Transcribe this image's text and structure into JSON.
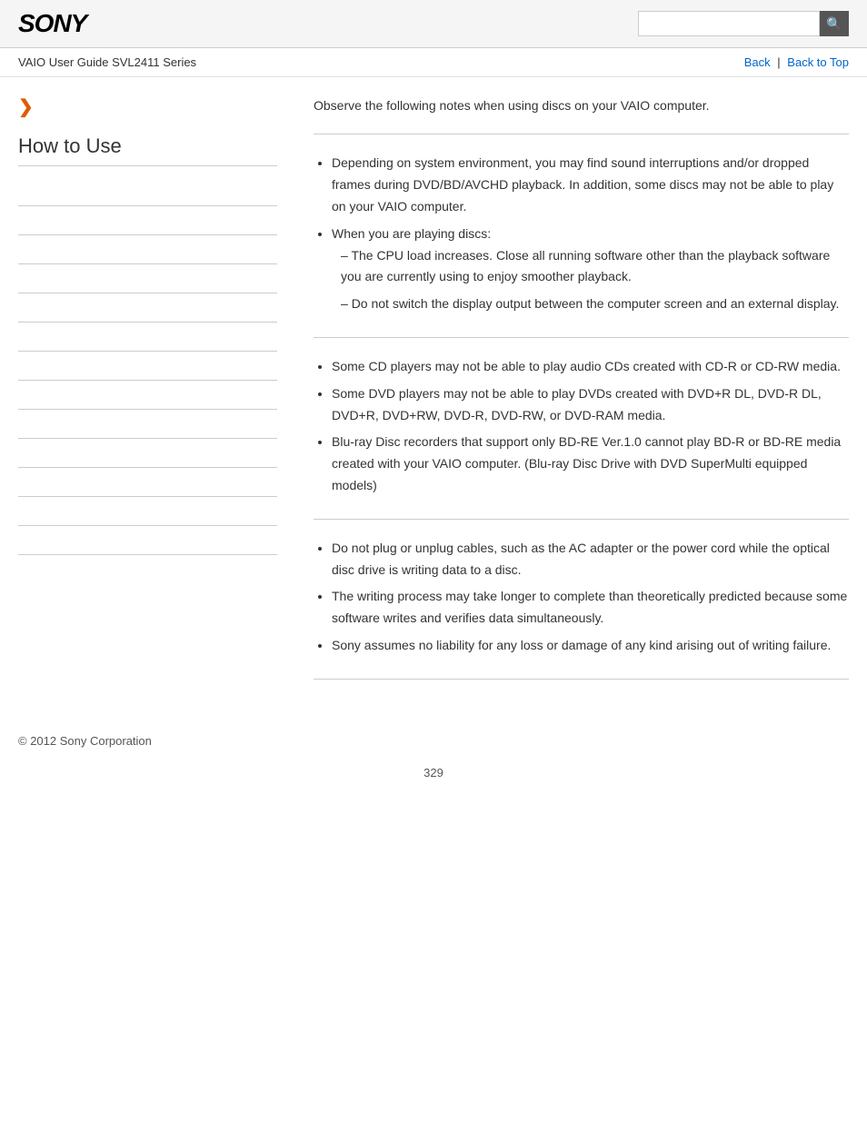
{
  "header": {
    "logo": "SONY",
    "search_placeholder": "",
    "search_icon": "🔍"
  },
  "nav": {
    "breadcrumb": "VAIO User Guide SVL2411 Series",
    "back_label": "Back",
    "separator": "|",
    "back_to_top_label": "Back to Top"
  },
  "sidebar": {
    "chevron": "❯",
    "title": "How to Use",
    "nav_items": [
      "",
      "",
      "",
      "",
      "",
      "",
      "",
      "",
      "",
      "",
      "",
      "",
      ""
    ]
  },
  "content": {
    "intro": "Observe the following notes when using discs on your VAIO computer.",
    "section1": {
      "items": [
        "Depending on system environment, you may find sound interruptions and/or dropped frames during DVD/BD/AVCHD playback. In addition, some discs may not be able to play on your VAIO computer.",
        "When you are playing discs:"
      ],
      "sub_items": [
        "The CPU load increases. Close all running software other than the playback software you are currently using to enjoy smoother playback.",
        "Do not switch the display output between the computer screen and an external display."
      ]
    },
    "section2": {
      "items": [
        "Some CD players may not be able to play audio CDs created with CD-R or CD-RW media.",
        "Some DVD players may not be able to play DVDs created with DVD+R DL, DVD-R DL, DVD+R, DVD+RW, DVD-R, DVD-RW, or DVD-RAM media.",
        "Blu-ray Disc recorders that support only BD-RE Ver.1.0 cannot play BD-R or BD-RE media created with your VAIO computer. (Blu-ray Disc Drive with DVD SuperMulti equipped models)"
      ]
    },
    "section3": {
      "items": [
        "Do not plug or unplug cables, such as the AC adapter or the power cord while the optical disc drive is writing data to a disc.",
        "The writing process may take longer to complete than theoretically predicted because some software writes and verifies data simultaneously.",
        "Sony assumes no liability for any loss or damage of any kind arising out of writing failure."
      ]
    }
  },
  "copyright": "© 2012 Sony Corporation",
  "page_number": "329"
}
